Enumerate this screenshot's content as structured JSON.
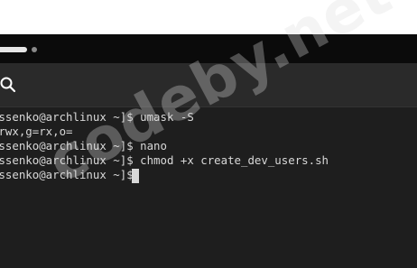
{
  "tabs": {
    "active_indicator": "tab-pill",
    "inactive_indicator": "tab-dot"
  },
  "search": {
    "icon": "search-icon"
  },
  "terminal": {
    "lines": [
      "sssenko@archlinux ~]$ umask -S",
      "=rwx,g=rx,o=",
      "sssenko@archlinux ~]$ nano",
      "sssenko@archlinux ~]$ chmod +x create_dev_users.sh",
      "sssenko@archlinux ~]$ "
    ]
  },
  "watermark": {
    "text": "codeby.net"
  },
  "colors": {
    "tabbar_bg": "#0b0b0b",
    "searchbar_bg": "#2a2a2a",
    "terminal_bg": "#1e1e1e",
    "terminal_fg": "#d8d8d8"
  }
}
